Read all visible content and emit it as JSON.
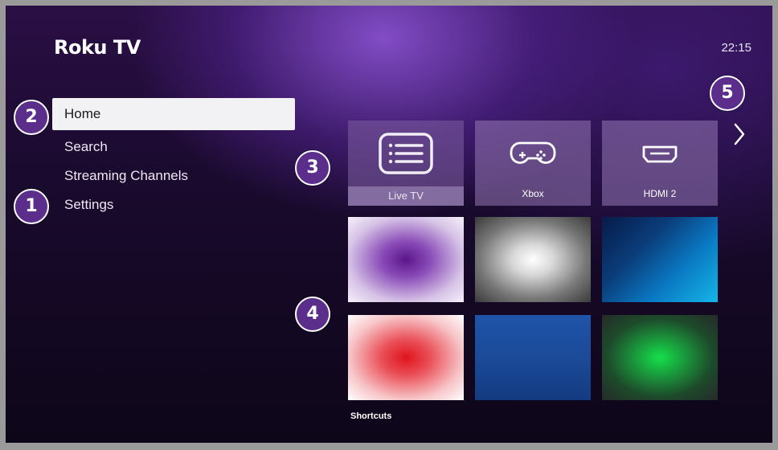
{
  "header": {
    "logo": "Roku TV",
    "time": "22:15"
  },
  "menu": {
    "items": [
      {
        "label": "Home",
        "active": true
      },
      {
        "label": "Search"
      },
      {
        "label": "Streaming Channels"
      },
      {
        "label": "Settings"
      }
    ]
  },
  "callouts": [
    "1",
    "2",
    "3",
    "4",
    "5"
  ],
  "inputs": [
    {
      "label": "Live TV",
      "icon": "guide-list-icon"
    },
    {
      "label": "Xbox",
      "icon": "gamepad-icon"
    },
    {
      "label": "HDMI 2",
      "icon": "hdmi-icon"
    }
  ],
  "shortcuts": {
    "label": "Shortcuts",
    "thumb_colors": [
      "#6a1f9a",
      "#ffffff",
      "#0098d8",
      "#e01e2a",
      "#1d4fa0",
      "#1ddc52"
    ]
  },
  "colors": {
    "badge": "#5b2e8c",
    "background": "#1a0a2e",
    "accent": "#7b45c0"
  }
}
